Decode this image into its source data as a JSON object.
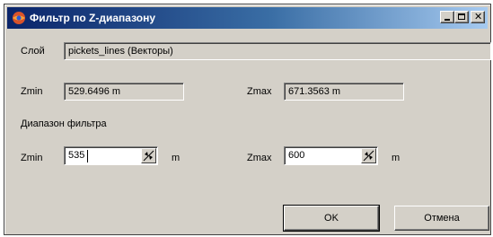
{
  "window": {
    "title": "Фильтр по Z-диапазону",
    "controls": {
      "minimize": "minimize",
      "maximize": "maximize",
      "close": "✕"
    }
  },
  "layer": {
    "label": "Слой",
    "value": "pickets_lines (Векторы)"
  },
  "source_range": {
    "zmin_label": "Zmin",
    "zmin_value": "529.6496 m",
    "zmax_label": "Zmax",
    "zmax_value": "671.3563 m"
  },
  "filter": {
    "section_label": "Диапазон фильтра",
    "zmin_label": "Zmin",
    "zmin_value": "535",
    "zmin_unit": "m",
    "zmax_label": "Zmax",
    "zmax_value": "600",
    "zmax_unit": "m"
  },
  "buttons": {
    "ok": "OK",
    "cancel": "Отмена"
  },
  "colors": {
    "titlebar_start": "#0a246a",
    "titlebar_end": "#a6caf0",
    "face": "#d4d0c8"
  }
}
